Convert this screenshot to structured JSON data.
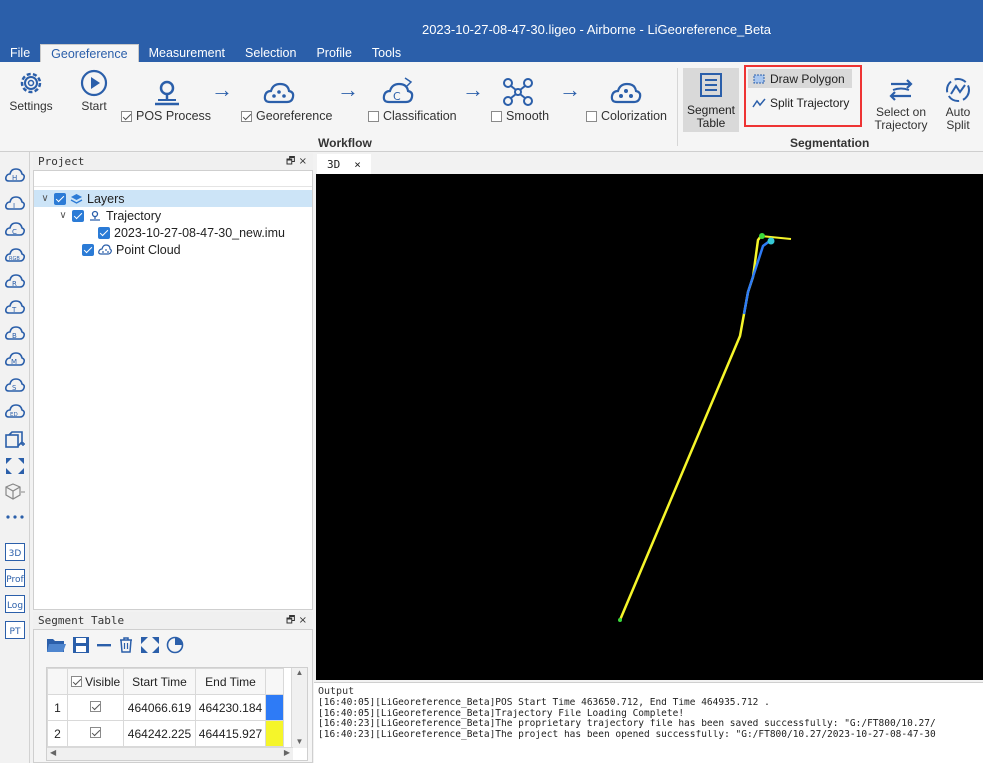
{
  "window": {
    "title": "2023-10-27-08-47-30.ligeo - Airborne - LiGeoreference_Beta"
  },
  "menu": [
    "File",
    "Georeference",
    "Measurement",
    "Selection",
    "Profile",
    "Tools"
  ],
  "ribbon": {
    "settings": "Settings",
    "start": "Start",
    "pos_process": "POS Process",
    "georeference": "Georeference",
    "classification": "Classification",
    "smooth": "Smooth",
    "colorization": "Colorization",
    "workflow_group": "Workflow",
    "segment_table_1": "Segment",
    "segment_table_2": "Table",
    "draw_polygon": "Draw Polygon",
    "split_trajectory": "Split Trajectory",
    "select_on_1": "Select on",
    "select_on_2": "Trajectory",
    "auto_1": "Auto",
    "auto_2": "Split",
    "segmentation_group": "Segmentation",
    "checks": {
      "pos_process": true,
      "georeference": true,
      "classification": false,
      "smooth": false,
      "colorization": false
    }
  },
  "left_toolbar": {
    "icons": [
      "h-cloud-icon",
      "i-cloud-icon",
      "c-cloud-icon",
      "rgb-cloud-icon",
      "r-cloud-icon",
      "t-cloud-icon",
      "b-cloud-icon",
      "m-cloud-icon",
      "s-cloud-icon",
      "ed-cloud-icon",
      "add-box-icon",
      "fit-view-icon",
      "cube-icon",
      "dots-icon"
    ],
    "boxes": [
      "3D",
      "Prof",
      "Log",
      "PT"
    ]
  },
  "project_panel": {
    "title": "Project",
    "tree": [
      {
        "label": "Layers",
        "level": 0
      },
      {
        "label": "Trajectory",
        "level": 1
      },
      {
        "label": "2023-10-27-08-47-30_new.imu",
        "level": 2
      },
      {
        "label": "Point Cloud",
        "level": 1
      }
    ]
  },
  "segment_panel": {
    "title": "Segment Table",
    "columns": [
      "Visible",
      "Start Time",
      "End Time"
    ],
    "rows": [
      {
        "index": "1",
        "visible": true,
        "start": "464066.619",
        "end": "464230.184",
        "color": "#2e7bf6"
      },
      {
        "index": "2",
        "visible": true,
        "start": "464242.225",
        "end": "464415.927",
        "color": "#f5f52a"
      }
    ]
  },
  "view_tab": {
    "label": "3D",
    "close": "×"
  },
  "output": {
    "title": "Output",
    "lines": [
      "[16:40:05][LiGeoreference_Beta]POS Start Time 463650.712, End Time 464935.712 .",
      "[16:40:05][LiGeoreference_Beta]Trajectory File Loading Complete!",
      "[16:40:23][LiGeoreference_Beta]The proprietary trajectory file has been saved successfully: \"G:/FT800/10.27/",
      "[16:40:23][LiGeoreference_Beta]The project has been opened successfully: \"G:/FT800/10.27/2023-10-27-08-47-30"
    ]
  },
  "colors": {
    "accent": "#2b5faa",
    "track_yellow": "#f5f52a",
    "track_blue": "#2e7bf6",
    "track_green": "#3ddc3d"
  }
}
